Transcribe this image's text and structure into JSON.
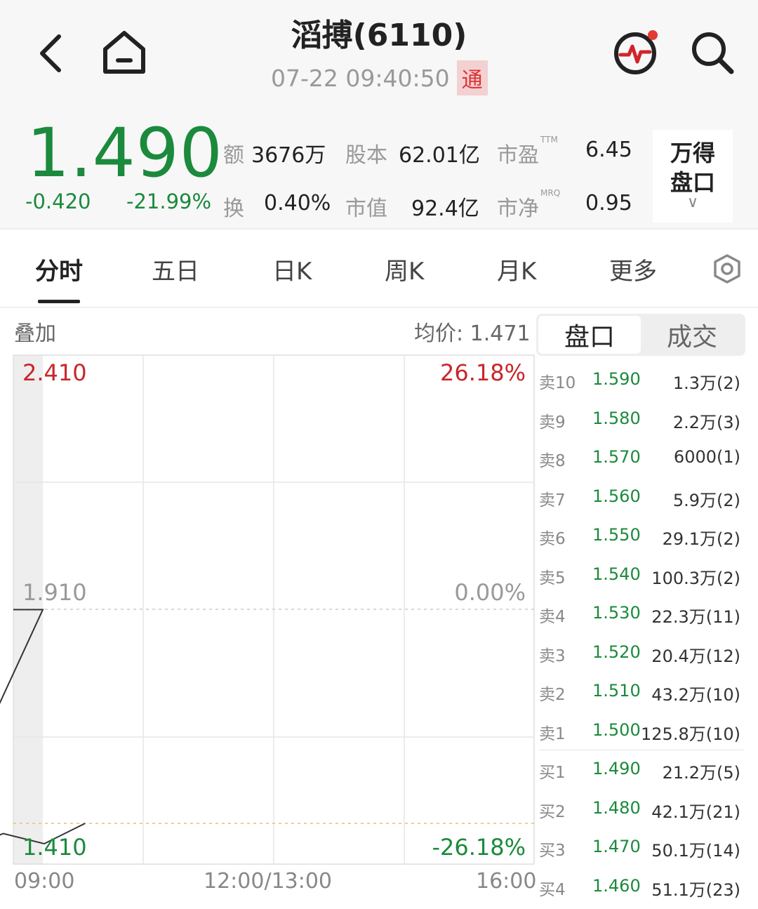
{
  "header": {
    "title": "滔搏(6110)",
    "time": "07-22 09:40:50",
    "tong_badge": "通"
  },
  "quote": {
    "price": "1.490",
    "change": "-0.420",
    "change_pct": "-21.99%",
    "stats": {
      "turnover_label": "额",
      "turnover": "3676万",
      "share_cap_label": "股本",
      "share_cap": "62.01亿",
      "pe_label": "市盈",
      "pe_sup": "TTM",
      "pe": "6.45",
      "turnover_rate_label": "换",
      "turnover_rate": "0.40%",
      "market_cap_label": "市值",
      "market_cap": "92.4亿",
      "pb_label": "市净",
      "pb_sup": "MRQ",
      "pb": "0.95"
    },
    "wind_button": {
      "line1": "万得",
      "line2": "盘口"
    }
  },
  "tabs": [
    {
      "label": "分时"
    },
    {
      "label": "五日"
    },
    {
      "label": "日K"
    },
    {
      "label": "周K"
    },
    {
      "label": "月K"
    },
    {
      "label": "更多"
    }
  ],
  "chart": {
    "overlay_label": "叠加",
    "avg_price": "均价: 1.471",
    "y_top": "2.410",
    "y_mid": "1.910",
    "y_bottom": "1.410",
    "pct_top": "26.18%",
    "pct_mid": "0.00%",
    "pct_bottom": "-26.18%",
    "x_start": "09:00",
    "x_mid": "12:00/13:00",
    "x_end": "16:00"
  },
  "chart_data": {
    "type": "line",
    "ylim": [
      1.41,
      2.41
    ],
    "x": [
      "09:00",
      "09:00",
      "09:05",
      "09:10",
      "09:20",
      "09:30",
      "09:40"
    ],
    "series": [
      {
        "values": [
          1.91,
          1.91,
          1.48,
          1.44,
          1.47,
          1.45,
          1.49
        ]
      }
    ]
  },
  "orderbook": {
    "tabs": [
      "盘口",
      "成交"
    ],
    "asks": [
      {
        "side": "卖10",
        "price": "1.590",
        "vol": "1.3万(2)"
      },
      {
        "side": "卖9",
        "price": "1.580",
        "vol": "2.2万(3)"
      },
      {
        "side": "卖8",
        "price": "1.570",
        "vol": "6000(1)"
      },
      {
        "side": "卖7",
        "price": "1.560",
        "vol": "5.9万(2)"
      },
      {
        "side": "卖6",
        "price": "1.550",
        "vol": "29.1万(2)"
      },
      {
        "side": "卖5",
        "price": "1.540",
        "vol": "100.3万(2)"
      },
      {
        "side": "卖4",
        "price": "1.530",
        "vol": "22.3万(11)"
      },
      {
        "side": "卖3",
        "price": "1.520",
        "vol": "20.4万(12)"
      },
      {
        "side": "卖2",
        "price": "1.510",
        "vol": "43.2万(10)"
      },
      {
        "side": "卖1",
        "price": "1.500",
        "vol": "125.8万(10)"
      }
    ],
    "bids": [
      {
        "side": "买1",
        "price": "1.490",
        "vol": "21.2万(5)"
      },
      {
        "side": "买2",
        "price": "1.480",
        "vol": "42.1万(21)"
      },
      {
        "side": "买3",
        "price": "1.470",
        "vol": "50.1万(14)"
      },
      {
        "side": "买4",
        "price": "1.460",
        "vol": "51.1万(23)"
      }
    ]
  },
  "colors": {
    "down": "#1b8a3c",
    "up": "#c8262b"
  }
}
